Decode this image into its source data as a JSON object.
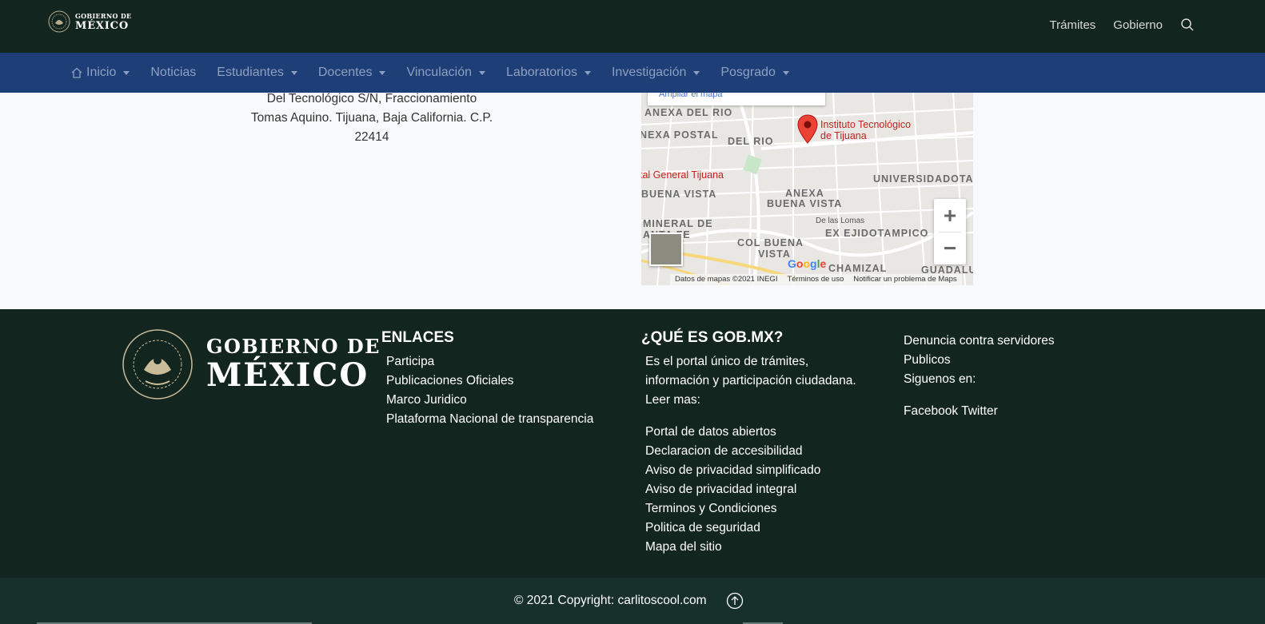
{
  "govbar": {
    "logo_line1": "GOBIERNO DE",
    "logo_line2": "MÉXICO",
    "links": [
      "Trámites",
      "Gobierno"
    ],
    "search_icon": "search-icon"
  },
  "navbar": {
    "items": [
      {
        "label": "Inicio",
        "dropdown": true,
        "icon": "home-icon"
      },
      {
        "label": "Noticias",
        "dropdown": false
      },
      {
        "label": "Estudiantes",
        "dropdown": true
      },
      {
        "label": "Docentes",
        "dropdown": true
      },
      {
        "label": "Vinculación",
        "dropdown": true
      },
      {
        "label": "Laboratorios",
        "dropdown": true
      },
      {
        "label": "Investigación",
        "dropdown": true
      },
      {
        "label": "Posgrado",
        "dropdown": true
      }
    ]
  },
  "address": {
    "line1": "Del Tecnológico S/N, Fraccionamiento",
    "line2": "Tomas Aquino. Tijuana, Baja California. C.P.",
    "line3": "22414"
  },
  "map": {
    "enlarge": "Ampliar el mapa",
    "poi_name_1": "Instituto Tecnológico",
    "poi_name_2": "de Tijuana",
    "poi_other": "tal General Tijuana",
    "areas": [
      "ANEXA DEL RIO",
      "NEXA POSTAL",
      "DEL RIO",
      "BUENA VISTA",
      "ANEXA",
      "BUENA VISTA",
      "UNIVERSIDADOTA",
      "MINERAL DE",
      "ANTA FE",
      "COL BUENA",
      "VISTA",
      "EX EJIDOTAMPICO",
      "CHAMIZAL",
      "GUADALUPE"
    ],
    "street": "De las Lomas",
    "zoom_in": "+",
    "zoom_out": "−",
    "google": "Google",
    "footer_data": "Datos de mapas ©2021 INEGI",
    "footer_terms": "Términos de uso",
    "footer_report": "Notificar un problema de Maps"
  },
  "footer": {
    "logo_line1": "GOBIERNO DE",
    "logo_line2": "MÉXICO",
    "enlaces": {
      "title": "ENLACES",
      "items": [
        "Participa",
        "Publicaciones Oficiales",
        "Marco Juridico",
        "Plataforma Nacional de transparencia"
      ]
    },
    "gob": {
      "title": "¿QUÉ ES GOB.MX?",
      "desc_1": "Es el portal único de trámites,",
      "desc_2": "información y participación ciudadana.",
      "desc_3": "Leer mas:",
      "items": [
        "Portal de datos abiertos",
        "Declaracion de accesibilidad",
        "Aviso de privacidad simplificado",
        "Aviso de privacidad integral",
        "Terminos y Condiciones",
        "Politica de seguridad",
        "Mapa del sitio"
      ]
    },
    "right": {
      "line1": "Denuncia contra servidores",
      "line2": "Publicos",
      "line3": "Siguenos en:",
      "social": "Facebook Twitter"
    }
  },
  "bottom": {
    "copyright": "© 2021 Copyright: carlitoscool.com",
    "up_icon": "arrow-up-circle-icon"
  },
  "colors": {
    "gov_bg": "#13251f",
    "nav_bg": "#1e3e77",
    "footer_bg": "#13251f",
    "bottom_bg": "#17302a",
    "content_bg": "#f8f9fa"
  }
}
